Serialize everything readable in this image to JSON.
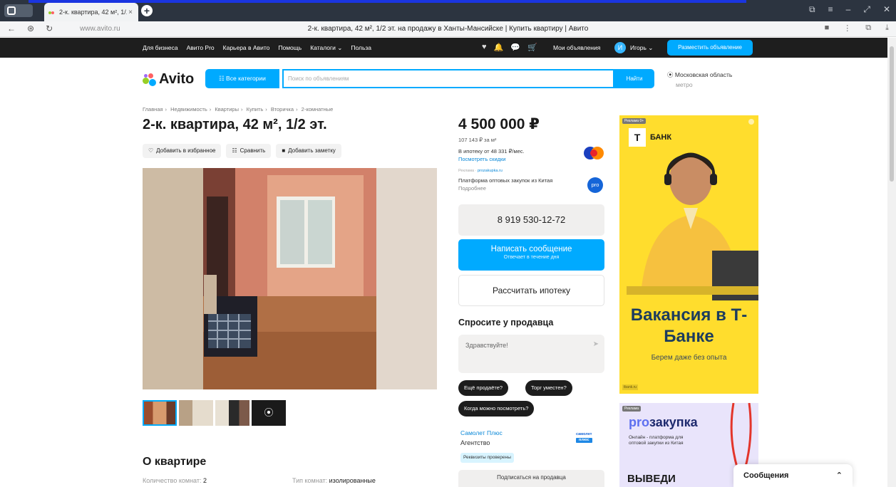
{
  "browser": {
    "tab_title": "2-к. квартира, 42 м², 1/...",
    "tab_close": "×",
    "new_tab": "+",
    "url": "www.avito.ru",
    "page_title": "2-к. квартира, 42 м², 1/2 эт. на продажу в Ханты-Мансийске | Купить квартиру | Авито",
    "nav_back": "←",
    "nav_shield": "⊛",
    "nav_reload": "↻",
    "win_ctrls": [
      "⧉",
      "≡",
      "–",
      "⤢",
      "✕"
    ],
    "addr_icons": [
      "■",
      "⋮",
      "⧉",
      "⤓"
    ]
  },
  "topnav": {
    "links": [
      "Для бизнеса",
      "Авито Pro",
      "Карьера в Авито",
      "Помощь",
      "Каталоги ⌄",
      "Польза"
    ],
    "icons": [
      "♥",
      "🔔",
      "💬",
      "🛒"
    ],
    "my_ads": "Мои объявления",
    "avatar_letter": "И",
    "username": "Игорь ⌄",
    "post_button": "Разместить объявление"
  },
  "header": {
    "logo": "Avito",
    "categories_button": "☷ Все категории",
    "search_placeholder": "Поиск по объявлениям",
    "search_button": "Найти",
    "location": "Московская область",
    "metro": "метро"
  },
  "listing": {
    "breadcrumbs": [
      "Главная",
      "Недвижимость",
      "Квартиры",
      "Купить",
      "Вторичка",
      "2-комнатные"
    ],
    "title": "2-к. квартира, 42 м², 1/2 эт.",
    "actions": [
      "Добавить в избранное",
      "Сравнить",
      "Добавить заметку"
    ],
    "action_icons": [
      "♡",
      "☷",
      "■"
    ],
    "thumb_play": "⦿",
    "about_heading": "О квартире",
    "about": [
      {
        "label": "Количество комнат: ",
        "value": "2"
      },
      {
        "label": "Тип комнат: ",
        "value": "изолированные"
      }
    ]
  },
  "sidebar": {
    "price": "4 500 000 ₽",
    "price_per_m2": "107 143 ₽ за м²",
    "mortgage_text": "В ипотеку от 48 331 ₽/мес.",
    "mortgage_link": "Посмотреть скидки",
    "ad_label": "Реклама",
    "ad_label_link": "prozakupka.ru",
    "ad_text": "Платформа оптовых закупок из Китая",
    "ad_more": "Подробнее",
    "ad_circle": "pro",
    "phone": "8 919 530-12-72",
    "message_button": "Написать сообщение",
    "message_sub": "Отвечает в течение дня",
    "calc_button": "Рассчитать ипотеку",
    "ask_heading": "Спросите у продавца",
    "ask_placeholder": "Здравствуйте!",
    "ask_send": "➤",
    "chips": [
      "Ещё продаёте?",
      "Торг уместен?",
      "Когда можно посмотреть?"
    ],
    "seller_name": "Самолет Плюс",
    "seller_type": "Агентство",
    "seller_logo": "самолет",
    "seller_logo_sub": "плюс",
    "verified": "Реквизиты проверены",
    "subscribe": "Подписаться на продавца"
  },
  "ads": {
    "tag": "Реклама",
    "tag_suffix": "0+",
    "tbank_letter": "T",
    "tbank_name": "БАНК",
    "headline": "Вакансия в Т-Банке",
    "subline": "Берем даже без опыта",
    "footer": "tbank.ru",
    "pz_title_a": "pro",
    "pz_title_b": "закупка",
    "pz_sub": "Онлайн - платформа для оптовой закупки из Китая",
    "pz_big": "ВЫВЕДИ"
  },
  "chat": {
    "label": "Сообщения",
    "chevron": "⌃"
  },
  "colors": {
    "accent": "#00aaff",
    "tbank_yellow": "#ffdd2d",
    "dark_nav": "#1e1e1e"
  }
}
